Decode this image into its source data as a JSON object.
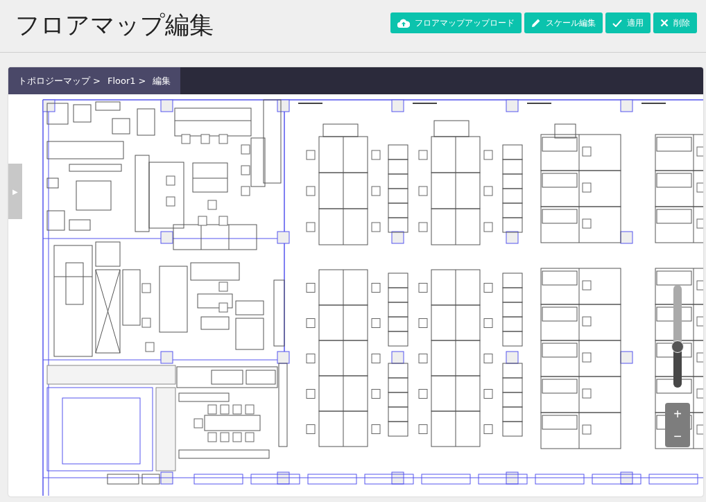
{
  "page": {
    "title": "フロアマップ編集"
  },
  "actions": [
    {
      "kind": "upload",
      "label": "フロアマップアップロード"
    },
    {
      "kind": "edit",
      "label": "スケール編集"
    },
    {
      "kind": "apply",
      "label": "適用"
    },
    {
      "kind": "delete",
      "label": "削除"
    }
  ],
  "breadcrumb": [
    {
      "label": "トポロジーマップ",
      "separator": ">"
    },
    {
      "label": "Floor1",
      "separator": ">"
    },
    {
      "label": "編集"
    }
  ],
  "side_toggle": {
    "glyph": "▶"
  },
  "zoom": {
    "level": 0.4,
    "zoom_in": "+",
    "zoom_out": "−"
  }
}
